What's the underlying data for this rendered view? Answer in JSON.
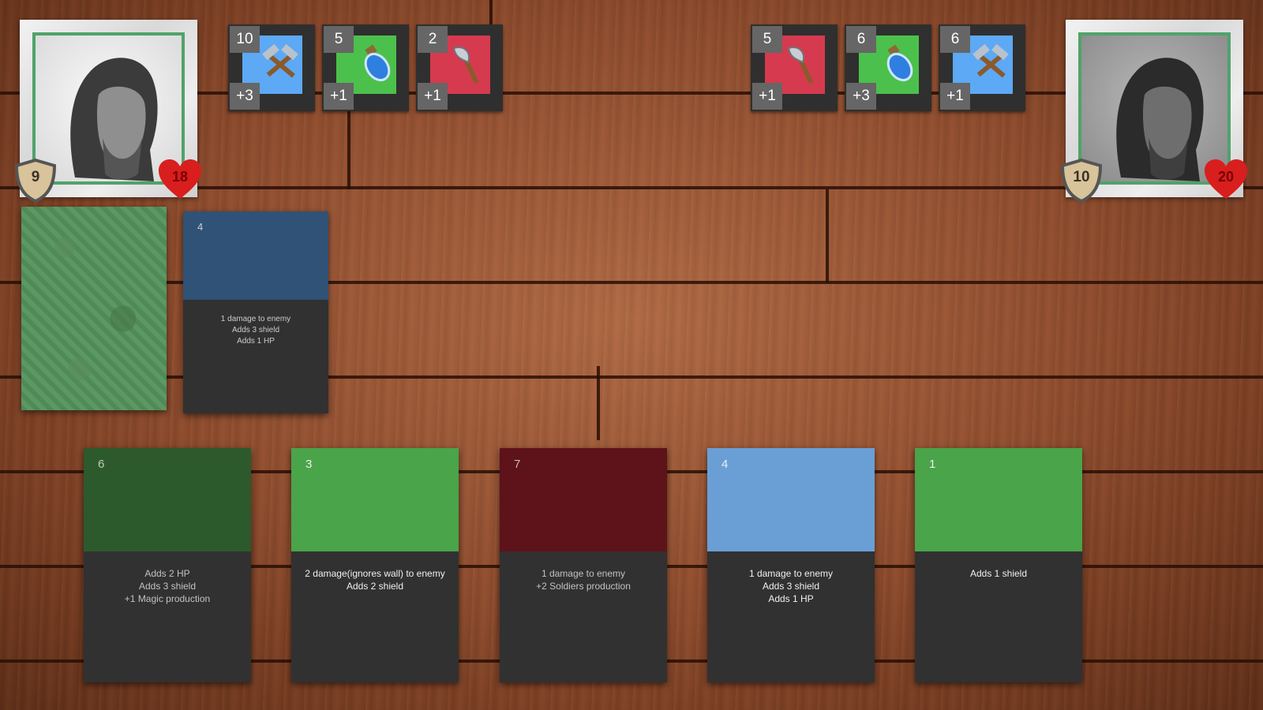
{
  "player": {
    "shield": "9",
    "hp": "18",
    "resources": [
      {
        "count": "10",
        "production": "+3",
        "color": "#5da9f5",
        "icon": "hammer-icon"
      },
      {
        "count": "5",
        "production": "+1",
        "color": "#4cc04c",
        "icon": "potion-icon"
      },
      {
        "count": "2",
        "production": "+1",
        "color": "#d63a4f",
        "icon": "axe-icon"
      }
    ]
  },
  "enemy": {
    "shield": "10",
    "hp": "20",
    "resources": [
      {
        "count": "5",
        "production": "+1",
        "color": "#d63a4f",
        "icon": "axe-icon"
      },
      {
        "count": "6",
        "production": "+3",
        "color": "#4cc04c",
        "icon": "potion-icon"
      },
      {
        "count": "6",
        "production": "+1",
        "color": "#5da9f5",
        "icon": "hammer-icon"
      }
    ]
  },
  "played_card": {
    "cost": "4",
    "color": "#2f5276",
    "lines": [
      "1 damage to enemy",
      "Adds 3 shield",
      "Adds 1 HP"
    ]
  },
  "hand": [
    {
      "cost": "6",
      "color": "#2d5a2d",
      "lines": [
        "Adds 2 HP",
        "Adds 3 shield",
        "+1 Magic production"
      ],
      "faded": true
    },
    {
      "cost": "3",
      "color": "#4aa44a",
      "lines": [
        "2 damage(ignores wall) to enemy",
        "Adds 2 shield"
      ],
      "faded": false
    },
    {
      "cost": "7",
      "color": "#5e1219",
      "lines": [
        "1 damage to enemy",
        "+2 Soldiers production"
      ],
      "faded": true
    },
    {
      "cost": "4",
      "color": "#6a9fd6",
      "lines": [
        "1 damage to enemy",
        "Adds 3 shield",
        "Adds 1 HP"
      ],
      "faded": false
    },
    {
      "cost": "1",
      "color": "#4aa44a",
      "lines": [
        "Adds 1 shield"
      ],
      "faded": false
    }
  ]
}
